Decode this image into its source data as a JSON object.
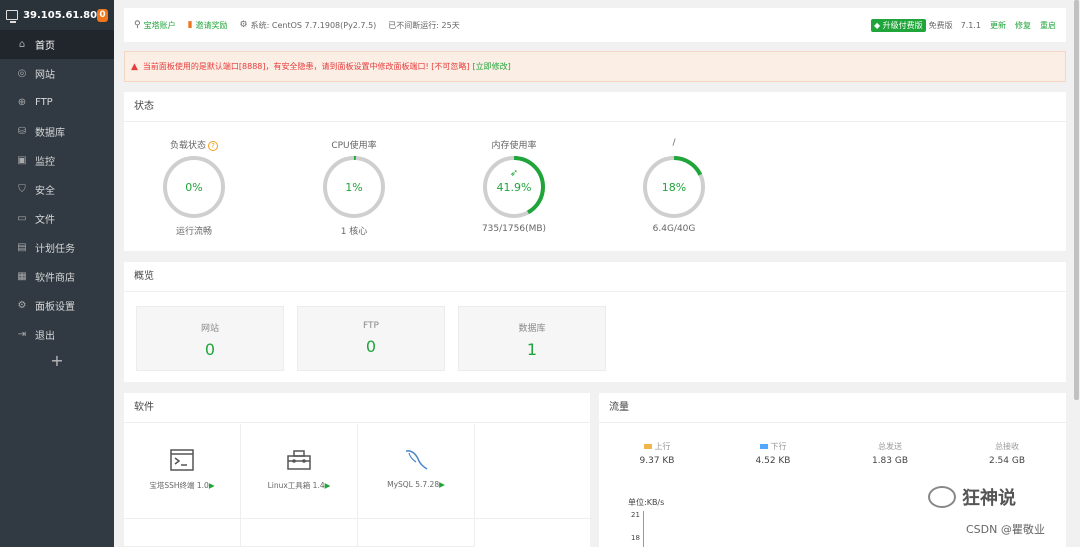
{
  "sidebar": {
    "ip": "39.105.61.80",
    "badge": "0",
    "items": [
      {
        "icon": "⌂",
        "label": "首页"
      },
      {
        "icon": "◎",
        "label": "网站"
      },
      {
        "icon": "⊕",
        "label": "FTP"
      },
      {
        "icon": "⛁",
        "label": "数据库"
      },
      {
        "icon": "▣",
        "label": "监控"
      },
      {
        "icon": "⛉",
        "label": "安全"
      },
      {
        "icon": "▭",
        "label": "文件"
      },
      {
        "icon": "▤",
        "label": "计划任务"
      },
      {
        "icon": "▦",
        "label": "软件商店"
      },
      {
        "icon": "⚙",
        "label": "面板设置"
      },
      {
        "icon": "⇥",
        "label": "退出"
      }
    ],
    "add": "+"
  },
  "topbar": {
    "account": "宝塔账户",
    "invite": "邀请奖励",
    "system": "系统:  CentOS 7.7.1908(Py2.7.5)",
    "uptime": "已不间断运行: 25天",
    "upgrade": "升级付费版",
    "edition": "免费版",
    "version": "7.1.1",
    "update": "更新",
    "repair": "修复",
    "restart": "重启"
  },
  "warning": {
    "text": "当前面板使用的是默认端口[8888]，有安全隐患，请到面板设置中修改面板端口! [不可忽略]",
    "fix": "[立即修改]"
  },
  "status": {
    "title": "状态",
    "gauges": [
      {
        "title": "负载状态",
        "value": "0%",
        "sub": "运行流畅",
        "pct": 0,
        "help": "?"
      },
      {
        "title": "CPU使用率",
        "value": "1%",
        "sub": "1 核心",
        "pct": 1
      },
      {
        "title": "内存使用率",
        "value": "41.9%",
        "sub": "735/1756(MB)",
        "pct": 41.9,
        "rocket": true
      },
      {
        "title": "/",
        "value": "18%",
        "sub": "6.4G/40G",
        "pct": 18
      }
    ]
  },
  "overview": {
    "title": "概览",
    "cards": [
      {
        "label": "网站",
        "value": "0"
      },
      {
        "label": "FTP",
        "value": "0"
      },
      {
        "label": "数据库",
        "value": "1"
      }
    ]
  },
  "software": {
    "title": "软件",
    "items": [
      {
        "name": "宝塔SSH终端 1.0",
        "icon": "terminal-icon"
      },
      {
        "name": "Linux工具箱 1.4",
        "icon": "toolbox-icon"
      },
      {
        "name": "MySQL 5.7.28",
        "icon": "mysql-icon"
      }
    ]
  },
  "traffic": {
    "title": "流量",
    "cols": [
      {
        "label": "上行",
        "value": "9.37 KB",
        "color": "#f0b54c"
      },
      {
        "label": "下行",
        "value": "4.52 KB",
        "color": "#52a9ff"
      },
      {
        "label": "总发送",
        "value": "1.83 GB"
      },
      {
        "label": "总接收",
        "value": "2.54 GB"
      }
    ],
    "unit": "单位:KB/s",
    "ticks": [
      "21",
      "18"
    ]
  },
  "watermark": {
    "text": "狂神说",
    "csdn": "CSDN @瞿敬业"
  },
  "colors": {
    "green": "#20a53a",
    "sidebar": "#313a43",
    "warn": "#e73c3c"
  }
}
